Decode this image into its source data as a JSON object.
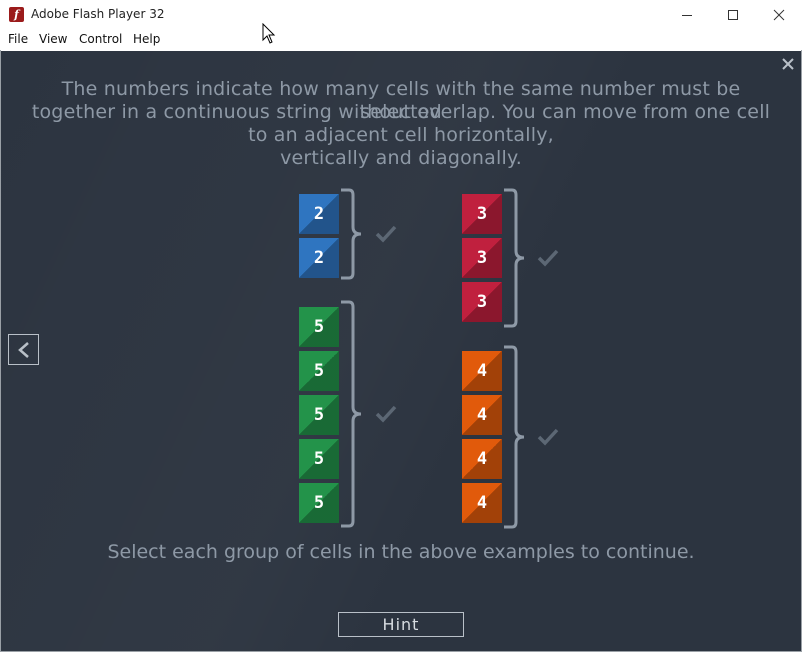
{
  "window": {
    "title": "Adobe Flash Player 32"
  },
  "menu": [
    "File",
    "View",
    "Control",
    "Help"
  ],
  "instructions": {
    "line1": "The numbers indicate how many cells with the same number must be selected",
    "line2": "together in a continuous string without overlap. You can move from one cell",
    "line3": "to an adjacent cell horizontally,",
    "line4": "vertically and diagonally."
  },
  "groups": [
    {
      "id": "blue",
      "number": "2",
      "color": "#2f75c0",
      "count": 2
    },
    {
      "id": "green",
      "number": "5",
      "color": "#23934a",
      "count": 5
    },
    {
      "id": "red",
      "number": "3",
      "color": "#c0203e",
      "count": 3
    },
    {
      "id": "orange",
      "number": "4",
      "color": "#e15a0b",
      "count": 4
    }
  ],
  "footer": "Select each group of cells in the above examples to continue.",
  "hint_label": "Hint",
  "icons": {
    "close": "close-icon",
    "back": "chevron-left-icon",
    "check": "checkmark-icon",
    "app": "flash-icon"
  }
}
